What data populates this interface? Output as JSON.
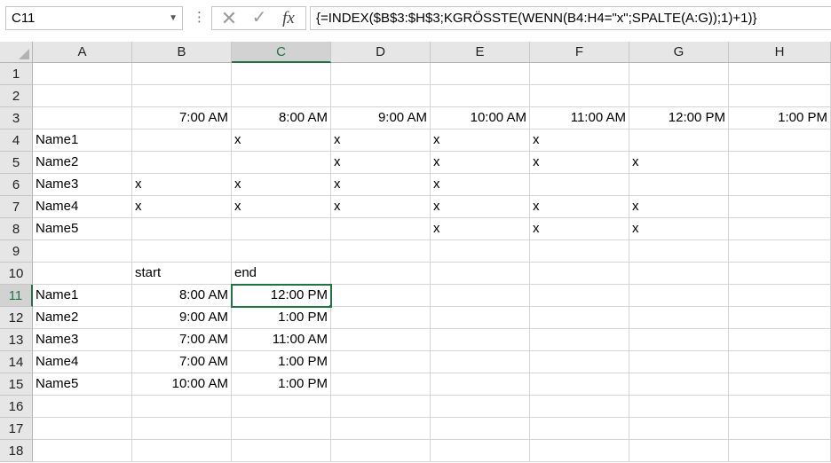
{
  "formula_bar": {
    "name_box": "C11",
    "more_icon": "vertical-dots-icon",
    "cancel_icon": "cross-icon",
    "enter_icon": "check-icon",
    "function_label": "fx",
    "formula": "{=INDEX($B$3:$H$3;KGRÖSSTE(WENN(B4:H4=\"x\";SPALTE(A:G));1)+1)}"
  },
  "columns": [
    "A",
    "B",
    "C",
    "D",
    "E",
    "F",
    "G",
    "H"
  ],
  "selected_column": "C",
  "selected_row": "11",
  "rows": [
    {
      "num": "1",
      "cells": [
        "",
        "",
        "",
        "",
        "",
        "",
        "",
        ""
      ]
    },
    {
      "num": "2",
      "cells": [
        "",
        "",
        "",
        "",
        "",
        "",
        "",
        ""
      ]
    },
    {
      "num": "3",
      "cells": [
        "",
        "7:00 AM",
        "8:00 AM",
        "9:00 AM",
        "10:00 AM",
        "11:00 AM",
        "12:00 PM",
        "1:00 PM"
      ]
    },
    {
      "num": "4",
      "cells": [
        "Name1",
        "",
        "x",
        "x",
        "x",
        "x",
        "",
        ""
      ]
    },
    {
      "num": "5",
      "cells": [
        "Name2",
        "",
        "",
        "x",
        "x",
        "x",
        "x",
        ""
      ]
    },
    {
      "num": "6",
      "cells": [
        "Name3",
        "x",
        "x",
        "x",
        "x",
        "",
        "",
        ""
      ]
    },
    {
      "num": "7",
      "cells": [
        "Name4",
        "x",
        "x",
        "x",
        "x",
        "x",
        "x",
        ""
      ]
    },
    {
      "num": "8",
      "cells": [
        "Name5",
        "",
        "",
        "",
        "x",
        "x",
        "x",
        ""
      ]
    },
    {
      "num": "9",
      "cells": [
        "",
        "",
        "",
        "",
        "",
        "",
        "",
        ""
      ]
    },
    {
      "num": "10",
      "cells": [
        "",
        "start",
        "end",
        "",
        "",
        "",
        "",
        ""
      ]
    },
    {
      "num": "11",
      "cells": [
        "Name1",
        "8:00 AM",
        "12:00 PM",
        "",
        "",
        "",
        "",
        ""
      ]
    },
    {
      "num": "12",
      "cells": [
        "Name2",
        "9:00 AM",
        "1:00 PM",
        "",
        "",
        "",
        "",
        ""
      ]
    },
    {
      "num": "13",
      "cells": [
        "Name3",
        "7:00 AM",
        "11:00 AM",
        "",
        "",
        "",
        "",
        ""
      ]
    },
    {
      "num": "14",
      "cells": [
        "Name4",
        "7:00 AM",
        "1:00 PM",
        "",
        "",
        "",
        "",
        ""
      ]
    },
    {
      "num": "15",
      "cells": [
        "Name5",
        "10:00 AM",
        "1:00 PM",
        "",
        "",
        "",
        "",
        ""
      ]
    },
    {
      "num": "16",
      "cells": [
        "",
        "",
        "",
        "",
        "",
        "",
        "",
        ""
      ]
    },
    {
      "num": "17",
      "cells": [
        "",
        "",
        "",
        "",
        "",
        "",
        "",
        ""
      ]
    },
    {
      "num": "18",
      "cells": [
        "",
        "",
        "",
        "",
        "",
        "",
        "",
        ""
      ]
    }
  ],
  "colors": {
    "accent": "#217346",
    "header_bg": "#e6e6e6",
    "gridline": "#d4d4d4"
  }
}
